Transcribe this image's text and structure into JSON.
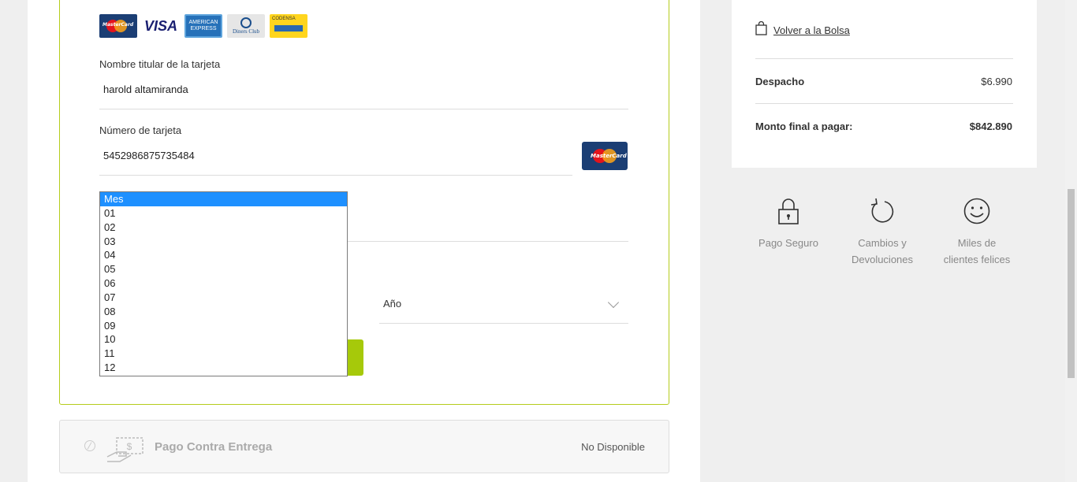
{
  "payment_logos": [
    {
      "icon": "mastercard-logo",
      "text": "MasterCard"
    },
    {
      "icon": "visa-logo",
      "text": "VISA"
    },
    {
      "icon": "amex-logo",
      "text": "AMERICAN EXPRESS"
    },
    {
      "icon": "diners-logo",
      "text": "Diners Club"
    },
    {
      "icon": "codensa-logo",
      "text": "CODENSA"
    }
  ],
  "card_form": {
    "holder_label": "Nombre titular de la tarjeta",
    "holder_value": "harold altamiranda",
    "number_label": "Número de tarjeta",
    "number_value": "5452986875735484",
    "detected_brand": "MasterCard",
    "year_placeholder": "Año",
    "month_options": [
      "Mes",
      "01",
      "02",
      "03",
      "04",
      "05",
      "06",
      "07",
      "08",
      "09",
      "10",
      "11",
      "12"
    ],
    "month_selected": "Mes"
  },
  "cash_on_delivery": {
    "title": "Pago Contra Entrega",
    "status": "No Disponible"
  },
  "summary": {
    "back_label": "Volver a la Bolsa",
    "shipping_label": "Despacho",
    "shipping_value": "$6.990",
    "total_label": "Monto final a pagar:",
    "total_value": "$842.890"
  },
  "trust_badges": [
    {
      "icon": "lock-icon",
      "label_lines": [
        "Pago Seguro"
      ]
    },
    {
      "icon": "refresh-icon",
      "label_lines": [
        "Cambios y",
        "Devoluciones"
      ]
    },
    {
      "icon": "smiley-icon",
      "label_lines": [
        "Miles de",
        "clientes felices"
      ]
    }
  ],
  "colors": {
    "accent_green": "#a6c90a",
    "selected_blue": "#1e90ff",
    "card_border": "#b5cc1c"
  }
}
